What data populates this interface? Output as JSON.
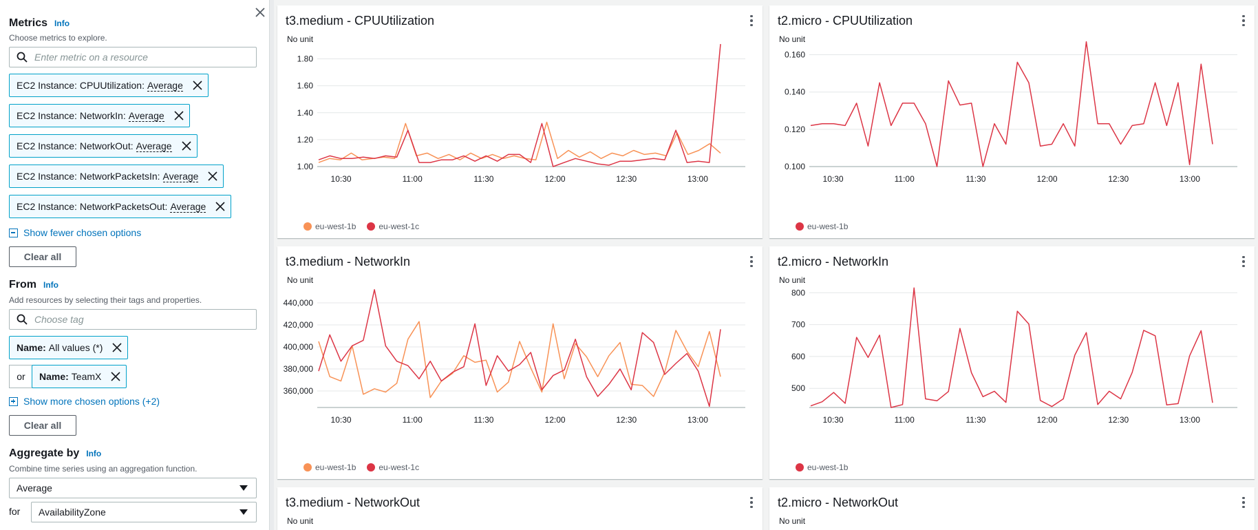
{
  "panel": {
    "metrics": {
      "title": "Metrics",
      "info": "Info",
      "description": "Choose metrics to explore.",
      "search_placeholder": "Enter metric on a resource",
      "tokens": [
        {
          "prefix": "EC2 Instance: CPUUtilization:",
          "agg": "Average"
        },
        {
          "prefix": "EC2 Instance: NetworkIn:",
          "agg": "Average"
        },
        {
          "prefix": "EC2 Instance: NetworkOut:",
          "agg": "Average"
        },
        {
          "prefix": "EC2 Instance: NetworkPacketsIn:",
          "agg": "Average"
        },
        {
          "prefix": "EC2 Instance: NetworkPacketsOut:",
          "agg": "Average"
        }
      ],
      "show_fewer": "Show fewer chosen options",
      "clear_all": "Clear all"
    },
    "from": {
      "title": "From",
      "info": "Info",
      "description": "Add resources by selecting their tags and properties.",
      "search_placeholder": "Choose tag",
      "tag1_key": "Name:",
      "tag1_val": "All values (*)",
      "or_label": "or",
      "tag2_key": "Name:",
      "tag2_val": "TeamX",
      "show_more": "Show more chosen options (+2)",
      "clear_all": "Clear all"
    },
    "aggregate": {
      "title": "Aggregate by",
      "info": "Info",
      "description": "Combine time series using an aggregation function.",
      "function": "Average",
      "for_label": "for",
      "group": "AvailabilityZone"
    }
  },
  "colors": {
    "eu_west_1b_two_series": "#f89256",
    "eu_west_1c": "#dc3545",
    "eu_west_1b_single": "#dc3545",
    "accent": "#0073bb"
  },
  "chart_data": [
    {
      "type": "line",
      "title": "t3.medium - CPUUtilization",
      "unit_label": "No unit",
      "x_ticks": [
        "10:30",
        "11:00",
        "11:30",
        "12:00",
        "12:30",
        "13:00"
      ],
      "x_range": [
        "10:20",
        "13:20"
      ],
      "y_ticks": [
        "1.00",
        "1.20",
        "1.40",
        "1.60",
        "1.80"
      ],
      "ylim": [
        1.0,
        1.9
      ],
      "series": [
        {
          "name": "eu-west-1b",
          "color": "#f89256",
          "values": [
            1.03,
            1.06,
            1.05,
            1.1,
            1.05,
            1.06,
            1.07,
            1.06,
            1.32,
            1.08,
            1.1,
            1.06,
            1.09,
            1.05,
            1.1,
            1.06,
            1.09,
            1.06,
            1.08,
            1.06,
            1.05,
            1.33,
            1.06,
            1.12,
            1.07,
            1.11,
            1.06,
            1.1,
            1.08,
            1.12,
            1.09,
            1.1,
            1.08,
            1.25,
            1.09,
            1.12,
            1.17,
            1.1
          ]
        },
        {
          "name": "eu-west-1c",
          "color": "#dc3545",
          "values": [
            1.05,
            1.08,
            1.06,
            1.06,
            1.07,
            1.06,
            1.08,
            1.07,
            1.27,
            1.03,
            1.03,
            1.05,
            1.05,
            1.08,
            1.04,
            1.08,
            1.04,
            1.09,
            1.09,
            1.03,
            1.32,
            1.0,
            1.03,
            1.06,
            1.04,
            1.02,
            1.01,
            1.04,
            1.04,
            1.05,
            1.06,
            1.05,
            1.27,
            1.03,
            1.04,
            1.03,
            1.91
          ]
        }
      ]
    },
    {
      "type": "line",
      "title": "t2.micro - CPUUtilization",
      "unit_label": "No unit",
      "x_ticks": [
        "10:30",
        "11:00",
        "11:30",
        "12:00",
        "12:30",
        "13:00"
      ],
      "x_range": [
        "10:20",
        "13:20"
      ],
      "y_ticks": [
        "0.100",
        "0.120",
        "0.140",
        "0.160"
      ],
      "ylim": [
        0.1,
        0.165
      ],
      "series": [
        {
          "name": "eu-west-1b",
          "color": "#dc3545",
          "values": [
            0.122,
            0.123,
            0.123,
            0.122,
            0.134,
            0.111,
            0.145,
            0.122,
            0.134,
            0.134,
            0.123,
            0.1,
            0.146,
            0.133,
            0.134,
            0.1,
            0.123,
            0.112,
            0.156,
            0.145,
            0.111,
            0.112,
            0.123,
            0.111,
            0.167,
            0.123,
            0.123,
            0.112,
            0.122,
            0.123,
            0.145,
            0.122,
            0.145,
            0.101,
            0.155,
            0.112
          ]
        }
      ]
    },
    {
      "type": "line",
      "title": "t3.medium - NetworkIn",
      "unit_label": "No unit",
      "x_ticks": [
        "10:30",
        "11:00",
        "11:30",
        "12:00",
        "12:30",
        "13:00"
      ],
      "x_range": [
        "10:20",
        "13:20"
      ],
      "y_ticks": [
        "360,000",
        "380,000",
        "400,000",
        "420,000",
        "440,000"
      ],
      "ylim": [
        345000,
        455000
      ],
      "series": [
        {
          "name": "eu-west-1b",
          "color": "#f89256",
          "values": [
            405000,
            373000,
            369000,
            401000,
            357000,
            362000,
            359000,
            367000,
            407000,
            423000,
            354000,
            369000,
            376000,
            392000,
            386000,
            388000,
            359000,
            368000,
            405000,
            381000,
            359000,
            421000,
            371000,
            403000,
            391000,
            373000,
            392000,
            404000,
            366000,
            365000,
            355000,
            377000,
            415000,
            396000,
            382000,
            414000,
            373000
          ]
        },
        {
          "name": "eu-west-1c",
          "color": "#dc3545",
          "values": [
            378000,
            411000,
            387000,
            401000,
            406000,
            452000,
            401000,
            387000,
            383000,
            371000,
            387000,
            369000,
            377000,
            382000,
            421000,
            365000,
            392000,
            378000,
            384000,
            395000,
            361000,
            374000,
            379000,
            407000,
            373000,
            355000,
            366000,
            380000,
            361000,
            413000,
            404000,
            375000,
            385000,
            394000,
            378000,
            346000,
            416000
          ]
        }
      ]
    },
    {
      "type": "line",
      "title": "t2.micro - NetworkIn",
      "unit_label": "No unit",
      "x_ticks": [
        "10:30",
        "11:00",
        "11:30",
        "12:00",
        "12:30",
        "13:00"
      ],
      "x_range": [
        "10:20",
        "13:20"
      ],
      "y_ticks": [
        "500",
        "600",
        "700",
        "800"
      ],
      "ylim": [
        440,
        820
      ],
      "series": [
        {
          "name": "eu-west-1b",
          "color": "#dc3545",
          "values": [
            445,
            458,
            487,
            453,
            660,
            597,
            667,
            440,
            449,
            815,
            467,
            461,
            490,
            688,
            549,
            474,
            491,
            456,
            742,
            702,
            462,
            443,
            467,
            604,
            675,
            449,
            491,
            467,
            550,
            682,
            665,
            448,
            452,
            602,
            681,
            455
          ]
        }
      ]
    },
    {
      "type": "line",
      "title": "t3.medium - NetworkOut",
      "unit_label": "No unit",
      "series": []
    },
    {
      "type": "line",
      "title": "t2.micro - NetworkOut",
      "unit_label": "No unit",
      "series": []
    }
  ]
}
